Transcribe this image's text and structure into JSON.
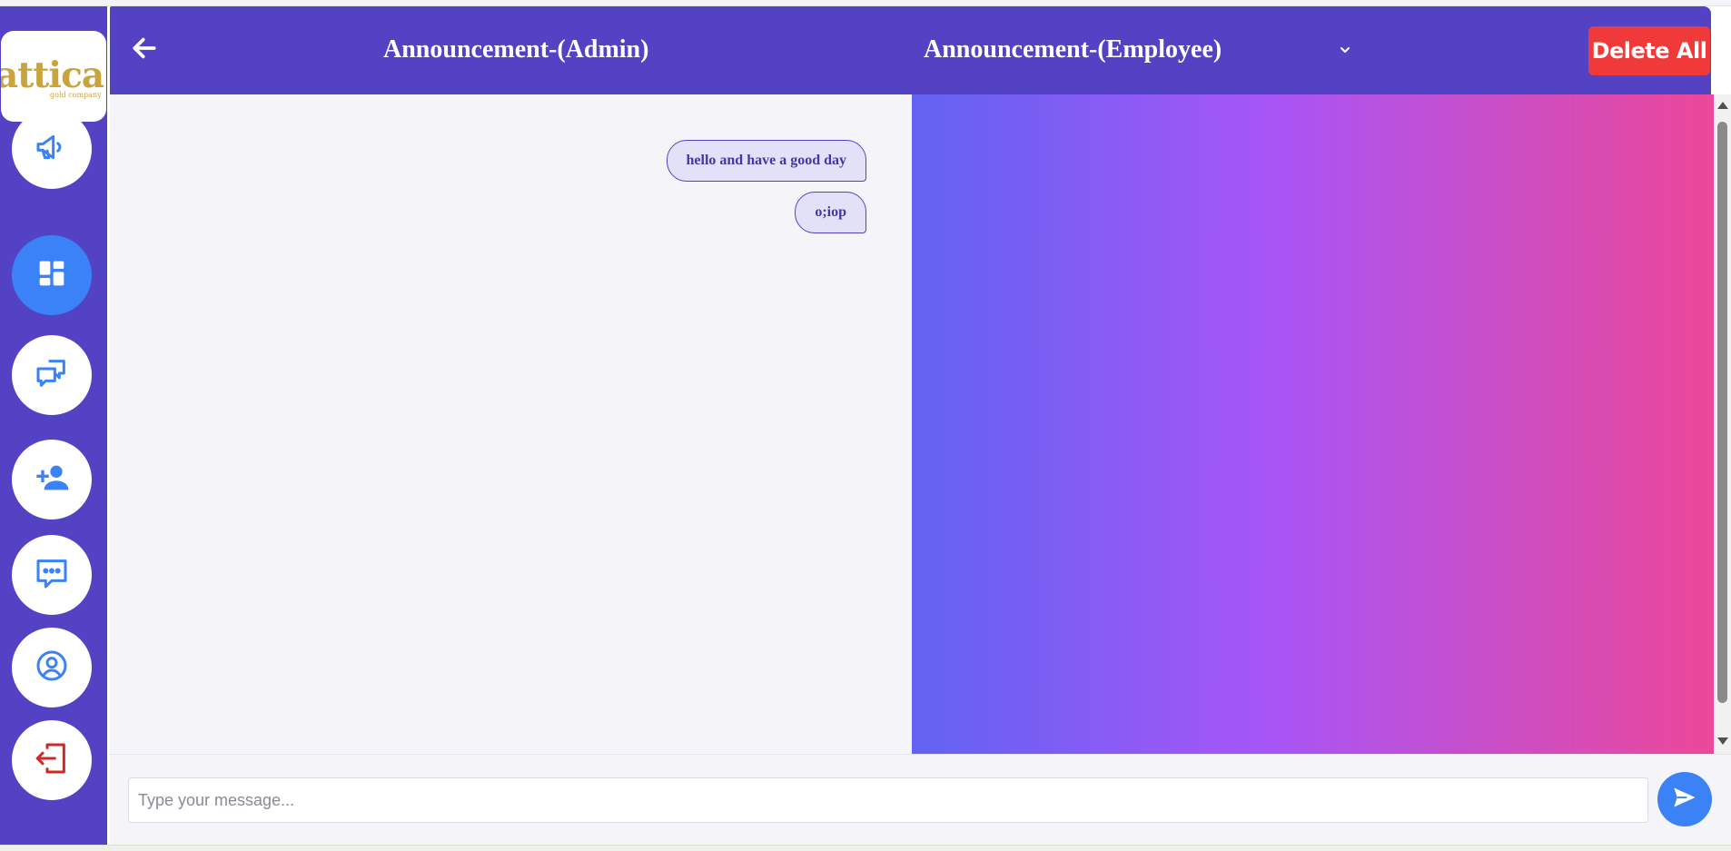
{
  "brand": {
    "name": "attica",
    "tagline": "gold company",
    "color": "#c9a43d"
  },
  "sidebar": {
    "items": [
      {
        "icon": "megaphone-icon",
        "active": false
      },
      {
        "icon": "dashboard-icon",
        "active": true
      },
      {
        "icon": "chat-bubbles-icon",
        "active": false
      },
      {
        "icon": "add-user-icon",
        "active": false
      },
      {
        "icon": "message-dots-icon",
        "active": false
      },
      {
        "icon": "user-circle-icon",
        "active": false
      },
      {
        "icon": "logout-icon",
        "active": false
      }
    ]
  },
  "header": {
    "tabs": [
      {
        "label": "Announcement-(Admin)"
      },
      {
        "label": "Announcement-(Employee)"
      }
    ],
    "delete_all_label": "Delete All"
  },
  "messages": [
    {
      "text": "hello and have a good day"
    },
    {
      "text": "o;iop"
    }
  ],
  "composer": {
    "placeholder": "Type your message...",
    "value": ""
  },
  "colors": {
    "primary": "#5343c4",
    "accent": "#3b82f6",
    "danger": "#f03a3a",
    "gradient_start": "#6263f1",
    "gradient_mid": "#a855f7",
    "gradient_end": "#ec4899"
  }
}
